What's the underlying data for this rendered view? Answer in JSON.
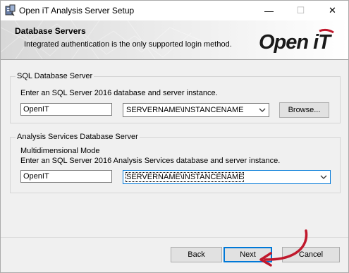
{
  "window": {
    "title": "Open iT Analysis Server Setup",
    "minimize": "—",
    "maximize": "☐",
    "close": "✕"
  },
  "banner": {
    "title": "Database Servers",
    "subtitle": "Integrated authentication is the only supported login method.",
    "logo_text": "Open iT"
  },
  "sql_group": {
    "legend": "SQL Database Server",
    "instruction": "Enter an SQL Server 2016 database and server instance.",
    "database_value": "OpenIT",
    "server_value": "SERVERNAME\\INSTANCENAME",
    "browse_label": "Browse..."
  },
  "as_group": {
    "legend": "Analysis Services Database Server",
    "mode": "Multidimensional Mode",
    "instruction": "Enter an SQL Server 2016 Analysis Services database and server instance.",
    "database_value": "OpenIT",
    "server_value": "SERVERNAME\\INSTANCENAME"
  },
  "footer": {
    "back_label": "Back",
    "next_label": "Next",
    "cancel_label": "Cancel"
  },
  "colors": {
    "accent": "#0078d7",
    "annotation": "#c0182c",
    "logo": "#1a1a1a",
    "logo_accent": "#c0182c"
  }
}
